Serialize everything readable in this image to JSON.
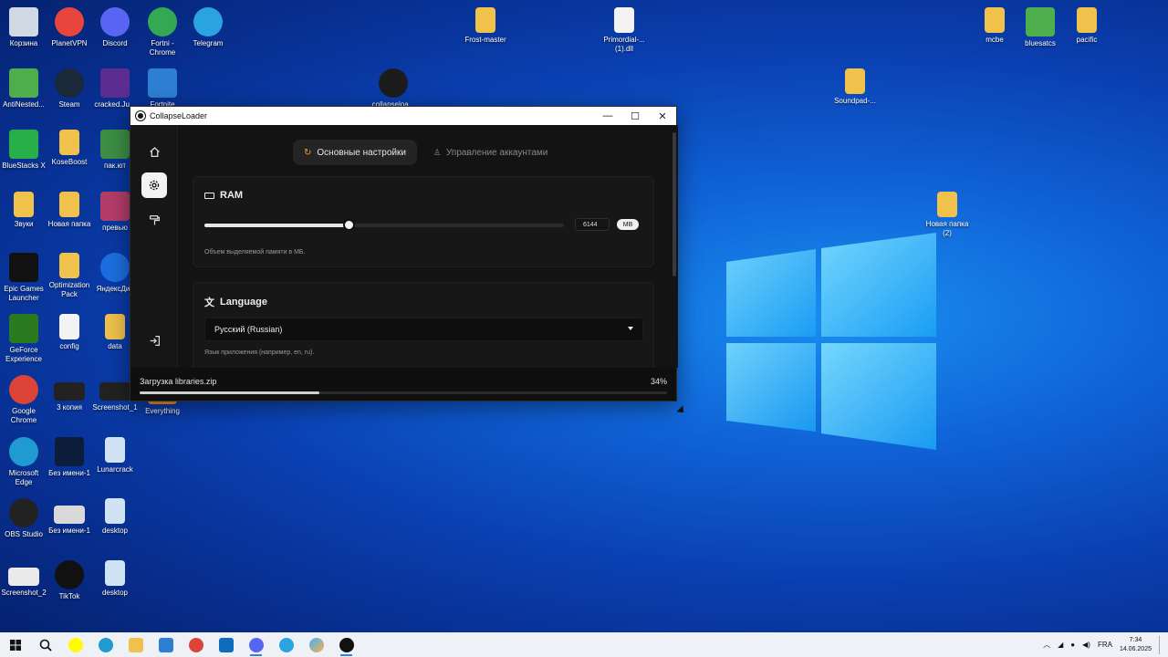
{
  "desktop": {
    "icons": [
      {
        "label": "Корзина",
        "icon": "recycle-bin-icon",
        "color": "#cfd8e3",
        "kind": "app"
      },
      {
        "label": "PlanetVPN",
        "icon": "planet-icon",
        "color": "#e8463c",
        "kind": "round"
      },
      {
        "label": "Discord",
        "icon": "discord-icon",
        "color": "#5865f2",
        "kind": "round"
      },
      {
        "label": "Fortni - Chrome",
        "icon": "chrome-icon",
        "color": "#34a853",
        "kind": "round"
      },
      {
        "label": "Telegram",
        "icon": "telegram-icon",
        "color": "#2aa3e0",
        "kind": "round"
      },
      {
        "label": "AntiNested...",
        "icon": "archive-icon",
        "color": "#4fae4c",
        "kind": "app"
      },
      {
        "label": "Steam",
        "icon": "steam-icon",
        "color": "#1b2838",
        "kind": "round"
      },
      {
        "label": "cracked.Ju...",
        "icon": "gear-icon",
        "color": "#5c2d91",
        "kind": "app"
      },
      {
        "label": "Fortnite",
        "icon": "fortnite-icon",
        "color": "#2d7fd3",
        "kind": "app"
      },
      {
        "label": "BlueStacks X",
        "icon": "bluestacks-icon",
        "color": "#27b04a",
        "kind": "app"
      },
      {
        "label": "KoseBoost",
        "icon": "folder-icon",
        "color": "#f0c24b",
        "kind": "folder"
      },
      {
        "label": "пак.ют",
        "icon": "archive-icon",
        "color": "#3d8f45",
        "kind": "app"
      },
      {
        "label": "Звуки",
        "icon": "folder-icon",
        "color": "#f0c24b",
        "kind": "folder"
      },
      {
        "label": "Новая папка",
        "icon": "folder-icon",
        "color": "#f0c24b",
        "kind": "folder"
      },
      {
        "label": "превью",
        "icon": "image-icon",
        "color": "#b53d6a",
        "kind": "app"
      },
      {
        "label": "Epic Games Launcher",
        "icon": "epic-icon",
        "color": "#111111",
        "kind": "app"
      },
      {
        "label": "Optimization Pack",
        "icon": "folder-icon",
        "color": "#f0c24b",
        "kind": "folder"
      },
      {
        "label": "ЯндексДис",
        "icon": "yandex-disk-icon",
        "color": "#1c6ee0",
        "kind": "round"
      },
      {
        "label": "GeForce Experience",
        "icon": "nvidia-icon",
        "color": "#2a7a1f",
        "kind": "app"
      },
      {
        "label": "config",
        "icon": "file-icon",
        "color": "#f3f3f3",
        "kind": "file"
      },
      {
        "label": "data",
        "icon": "folder-icon",
        "color": "#f0c24b",
        "kind": "folder"
      },
      {
        "label": "Google Chrome",
        "icon": "chrome-icon",
        "color": "#db4437",
        "kind": "round"
      },
      {
        "label": "3 копия",
        "icon": "image-icon",
        "color": "#222222",
        "kind": "shot"
      },
      {
        "label": "Screenshot_1",
        "icon": "image-icon",
        "color": "#222222",
        "kind": "shot"
      },
      {
        "label": "Everything",
        "icon": "search-icon",
        "color": "#f08a24",
        "kind": "app"
      },
      {
        "label": "Microsoft Edge",
        "icon": "edge-icon",
        "color": "#1f9bd1",
        "kind": "round"
      },
      {
        "label": "Без имени-1",
        "icon": "psd-icon",
        "color": "#0b1d3a",
        "kind": "app"
      },
      {
        "label": "Lunarcrack",
        "icon": "gear-icon",
        "color": "#cfe3f5",
        "kind": "file"
      },
      {
        "label": "OBS Studio",
        "icon": "obs-icon",
        "color": "#222222",
        "kind": "round"
      },
      {
        "label": "Без имени-1",
        "icon": "image-icon",
        "color": "#d9d9d9",
        "kind": "shot"
      },
      {
        "label": "desktop",
        "icon": "gear-icon",
        "color": "#cfe3f5",
        "kind": "file"
      },
      {
        "label": "Screenshot_2",
        "icon": "image-icon",
        "color": "#eaeaea",
        "kind": "shot"
      },
      {
        "label": "TikTok",
        "icon": "tiktok-icon",
        "color": "#111111",
        "kind": "round"
      },
      {
        "label": "desktop",
        "icon": "gear-icon",
        "color": "#cfe3f5",
        "kind": "file"
      },
      {
        "label": "Frost-master",
        "icon": "folder-icon",
        "color": "#f0c24b",
        "kind": "folder"
      },
      {
        "label": "Primordial-... (1).dll",
        "icon": "dll-file-icon",
        "color": "#f3f3f3",
        "kind": "file"
      },
      {
        "label": "collapseloa...",
        "icon": "collapse-icon",
        "color": "#1c1c1c",
        "kind": "round"
      },
      {
        "label": "Soundpad-...",
        "icon": "archive-icon",
        "color": "#f0c24b",
        "kind": "folder"
      },
      {
        "label": "mcbe",
        "icon": "folder-icon",
        "color": "#f0c24b",
        "kind": "folder"
      },
      {
        "label": "bluesatcs",
        "icon": "archive-icon",
        "color": "#4fae4c",
        "kind": "app"
      },
      {
        "label": "pacific",
        "icon": "folder-icon",
        "color": "#f0c24b",
        "kind": "folder"
      },
      {
        "label": "Новая папка (2)",
        "icon": "archive-icon",
        "color": "#f0c24b",
        "kind": "folder"
      }
    ]
  },
  "window": {
    "title": "CollapseLoader",
    "minimize": "—",
    "maximize": "☐",
    "close": "✕",
    "tabs": [
      {
        "label": "Основные настройки",
        "icon": "refresh-icon",
        "active": true
      },
      {
        "label": "Управление аккаунтами",
        "icon": "user-icon",
        "active": false
      }
    ],
    "ram": {
      "title": "RAM",
      "value": "6144",
      "unit": "MB",
      "slider_fraction": 0.4,
      "hint": "Объем выделяемой памяти в МБ."
    },
    "language": {
      "title": "Language",
      "selected": "Русский (Russian)",
      "hint": "Язык приложения (например, en, ru)."
    },
    "status": {
      "label": "Загрузка libraries.zip",
      "percent": "34%",
      "progress": 0.34
    }
  },
  "taskbar": {
    "lang": "FRA",
    "time": "7:34",
    "date": "14.06.2025"
  }
}
